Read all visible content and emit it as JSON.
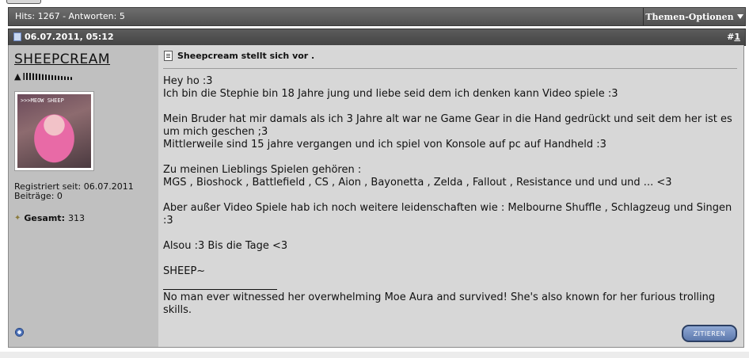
{
  "thread_bar": {
    "hits_text": "Hits: 1267 - Antworten: 5",
    "options_label": "Themen-Optionen"
  },
  "post_bar": {
    "date": "06.07.2011, 05:12",
    "post_number_prefix": "#",
    "post_number": "1"
  },
  "user": {
    "name": "SHEEPCREAM",
    "avatar_caption": ">>>MEOW SHEEP",
    "registered": "Registriert seit: 06.07.2011",
    "posts": "Beiträge: 0",
    "total_label": "Gesamt:",
    "total_value": "313"
  },
  "post": {
    "title": "Sheepcream stellt sich vor .",
    "paragraphs": [
      "Hey ho :3\nIch bin die Stephie bin 18 Jahre jung und liebe seid dem ich denken kann Video spiele :3",
      "Mein Bruder hat mir damals als ich 3 Jahre alt war ne Game Gear in die Hand gedrückt und seit dem her ist es um mich geschen ;3\nMittlerweile sind 15 jahre vergangen und ich spiel von Konsole auf pc auf Handheld :3",
      "Zu meinen Lieblings Spielen gehören :\nMGS , Bioshock , Battlefield , CS , Aion , Bayonetta , Zelda , Fallout , Resistance und und und ... <3",
      "Aber außer Video Spiele hab ich noch weitere leidenschaften wie : Melbourne Shuffle , Schlagzeug und Singen :3",
      "Alsou :3 Bis die Tage <3",
      "SHEEP~"
    ],
    "signature": "No man ever witnessed her overwhelming Moe Aura and survived! She's also known for her furious trolling skills."
  },
  "actions": {
    "quote_label": "ZITIEREN"
  },
  "icons": {
    "options": "chevron-down-icon",
    "post_date": "document-icon",
    "rank": "trophy-icon",
    "total": "stars-icon",
    "title": "note-icon",
    "status": "online-status-icon"
  }
}
